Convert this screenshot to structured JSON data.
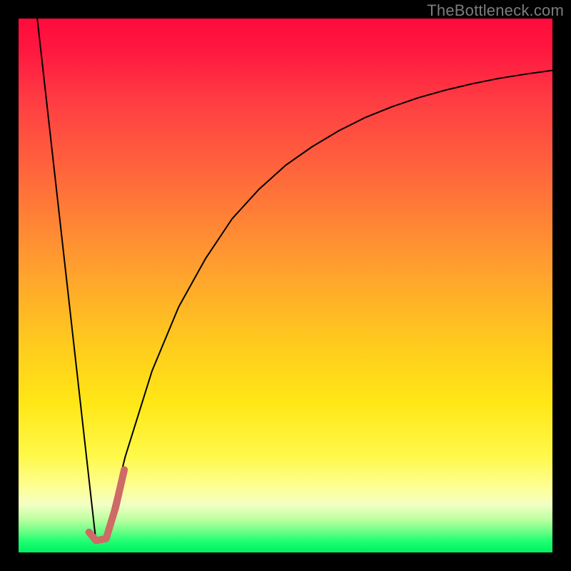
{
  "watermark": "TheBottleneck.com",
  "chart_data": {
    "type": "line",
    "title": "",
    "xlabel": "",
    "ylabel": "",
    "xlim": [
      0,
      100
    ],
    "ylim": [
      0,
      100
    ],
    "grid": false,
    "legend": false,
    "background_gradient": {
      "top_color": "#ff0b3b",
      "bottom_color": "#00f060",
      "description": "vertical red-to-green gradient (bottleneck severity scale)"
    },
    "series": [
      {
        "name": "left-falling-line",
        "color": "#000000",
        "stroke_width": 2,
        "x": [
          3.5,
          14.5
        ],
        "y": [
          100,
          2
        ]
      },
      {
        "name": "rising-asymptotic-curve",
        "color": "#000000",
        "stroke_width": 2,
        "x": [
          16,
          20,
          25,
          30,
          35,
          40,
          45,
          50,
          55,
          60,
          65,
          70,
          75,
          80,
          85,
          90,
          95,
          100
        ],
        "y": [
          2,
          18,
          34,
          46,
          55,
          62.5,
          68,
          72.5,
          76,
          79,
          81.5,
          83.5,
          85.2,
          86.6,
          87.8,
          88.8,
          89.6,
          90.3
        ]
      },
      {
        "name": "highlight-hook",
        "color": "#cf6a66",
        "stroke_width": 10,
        "description": "thick J-shaped marker near curve minimum",
        "x": [
          13.2,
          14.5,
          16.4,
          18.2,
          19.8
        ],
        "y": [
          3.8,
          2.2,
          2.6,
          8.5,
          15.5
        ]
      }
    ]
  }
}
